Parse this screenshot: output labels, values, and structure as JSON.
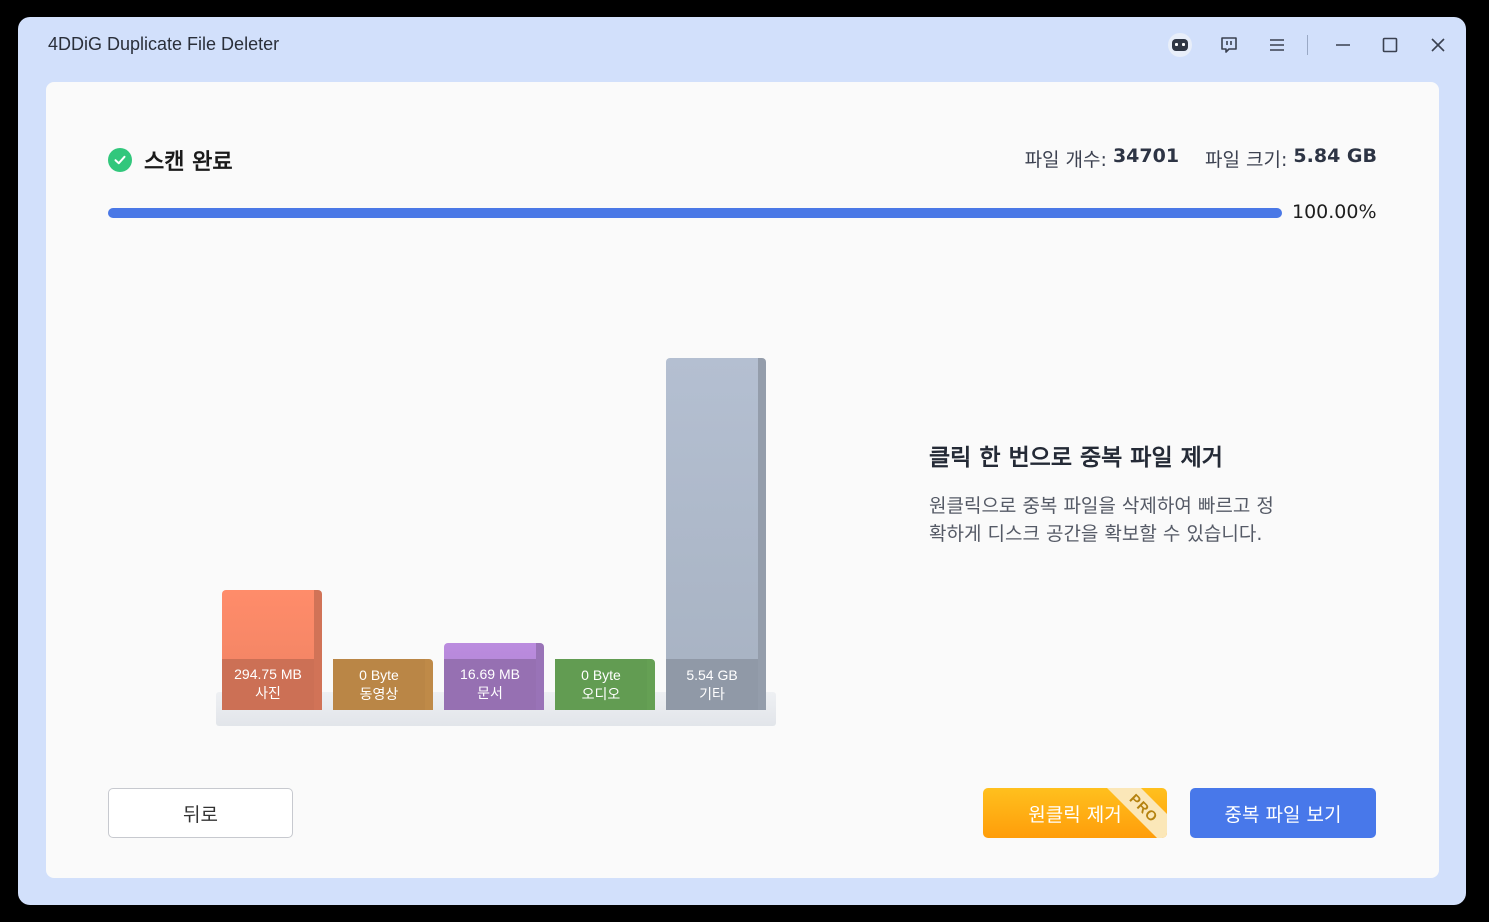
{
  "window": {
    "title": "4DDiG Duplicate File Deleter"
  },
  "titlebar": {
    "icons": [
      "robot-icon",
      "feedback-icon",
      "menu-icon",
      "minimize-icon",
      "maximize-icon",
      "close-icon"
    ]
  },
  "status": {
    "label": "스캔 완료",
    "check_color": "#31c77c"
  },
  "stats": {
    "count_label": "파일 개수:",
    "count_value": "34701",
    "size_label": "파일 크기:",
    "size_value": "5.84 GB"
  },
  "progress": {
    "percent_text": "100.00%",
    "fraction": 1.0,
    "color": "#4a78e6"
  },
  "chart_data": {
    "type": "bar",
    "categories": [
      "사진",
      "동영상",
      "문서",
      "오디오",
      "기타"
    ],
    "value_labels": [
      "294.75 MB",
      "0 Byte",
      "16.69 MB",
      "0 Byte",
      "5.54 GB"
    ],
    "values_bytes": [
      309067776,
      0,
      17500160,
      0,
      5948483584
    ],
    "colors": [
      "#ff8c6a",
      "#e9a858",
      "#bb8cdf",
      "#7bc366",
      "#b4bfd1"
    ]
  },
  "info": {
    "title": "클릭 한 번으로 중복 파일 제거",
    "line1": "원클릭으로 중복 파일을 삭제하여 빠르고 정",
    "line2": "확하게 디스크 공간을 확보할 수 있습니다."
  },
  "buttons": {
    "back": "뒤로",
    "oneclick": "원클릭 제거",
    "pro_badge": "PRO",
    "view": "중복 파일 보기"
  }
}
